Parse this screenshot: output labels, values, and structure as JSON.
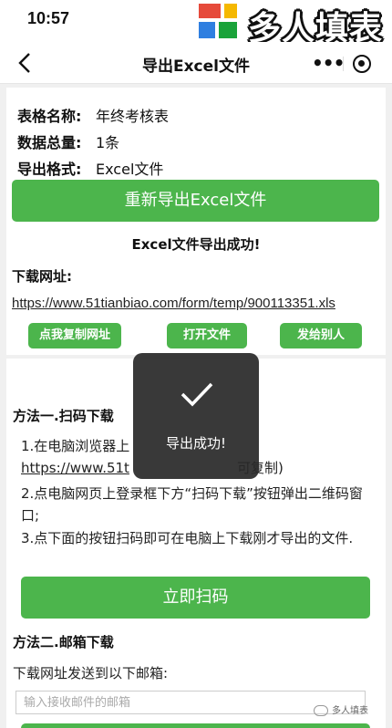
{
  "status": {
    "time": "10:57"
  },
  "brand": {
    "text": "多人填表",
    "logo_colors": [
      "#e64a3b",
      "#f5b800",
      "#2f7fe0",
      "#1aa33a"
    ]
  },
  "nav": {
    "title": "导出Excel文件",
    "back_icon": "chevron-left-icon",
    "more_label": "•••",
    "close_icon": "target-icon"
  },
  "info": {
    "form_name_label": "表格名称:",
    "form_name_value": "年终考核表",
    "total_label": "数据总量:",
    "total_value": "1条",
    "format_label": "导出格式:",
    "format_value": "Excel文件"
  },
  "actions": {
    "reexport_label": "重新导出Excel文件",
    "success_msg": "Excel文件导出成功!",
    "download_label": "下载网址:",
    "download_url": "https://www.51tianbiao.com/form/temp/900113351.xls",
    "copy_label": "点我复制网址",
    "open_label": "打开文件",
    "send_label": "发给别人"
  },
  "method1": {
    "title": "方法一.扫码下载",
    "step1_a": "1.在电脑浏览器上",
    "step1_url": "https://www.51t",
    "step1_b": "可复制)",
    "step2": "2.点电脑网页上登录框下方“扫码下载”按钮弹出二维码窗口;",
    "step3": "3.点下面的按钮扫码即可在电脑上下载刚才导出的文件.",
    "scan_label": "立即扫码"
  },
  "method2": {
    "title": "方法二.邮箱下载",
    "mail_label": "下载网址发送到以下邮箱:",
    "mail_placeholder": "输入接收邮件的邮箱"
  },
  "toast": {
    "text": "导出成功!",
    "icon": "checkmark-icon"
  },
  "watermark": {
    "text": "多人填表"
  },
  "colors": {
    "accent": "#4cb54c",
    "toast_bg": "#282828"
  }
}
